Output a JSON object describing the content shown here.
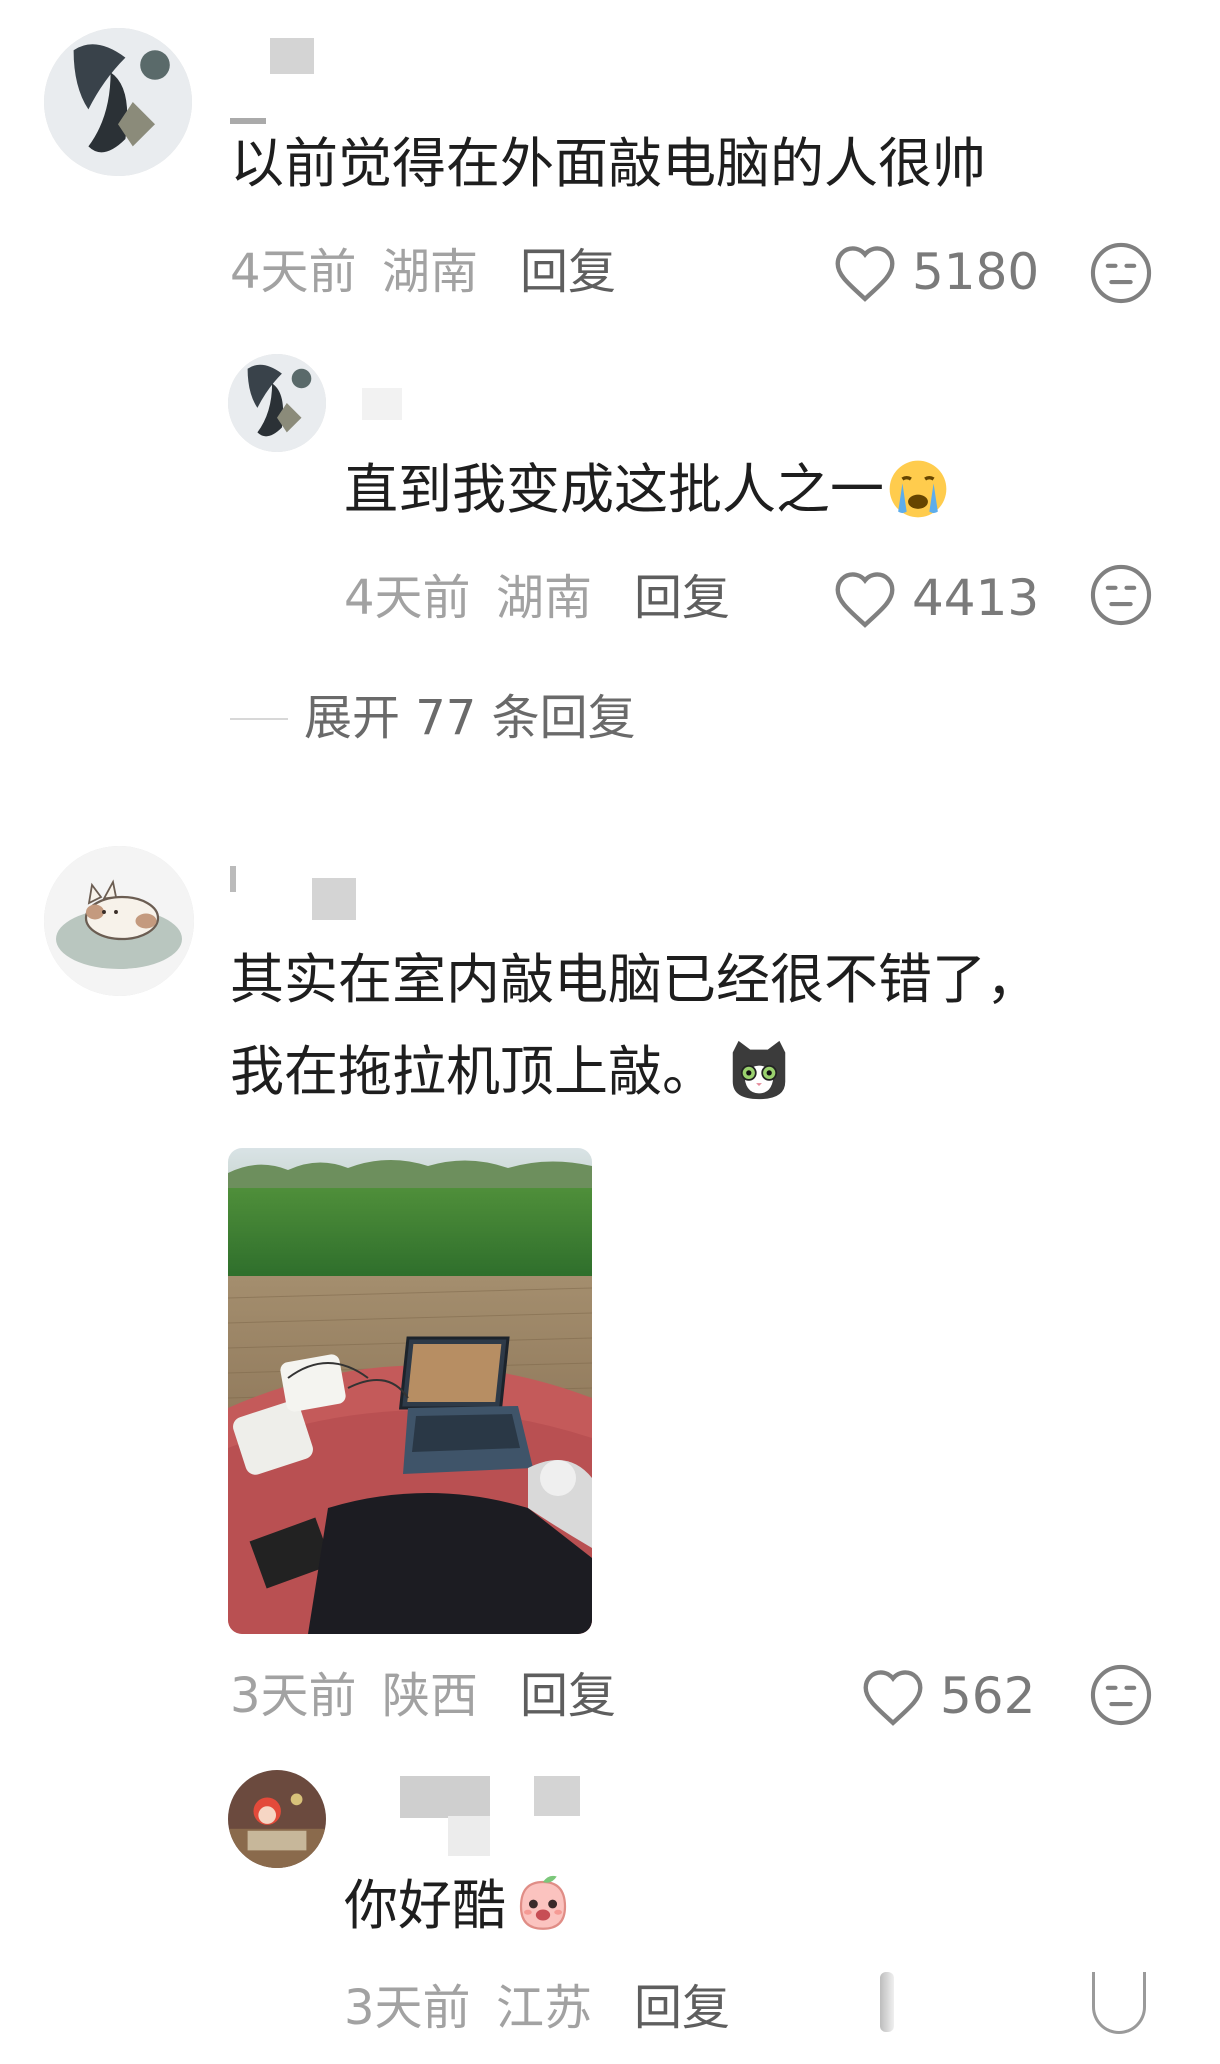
{
  "comments": [
    {
      "text": "以前觉得在外面敲电脑的人很帅",
      "time": "4天前",
      "location": "湖南",
      "reply_label": "回复",
      "likes": "5180",
      "replies": [
        {
          "text": "直到我变成这批人之一",
          "emoji": "crying-face",
          "time": "4天前",
          "location": "湖南",
          "reply_label": "回复",
          "likes": "4413"
        }
      ],
      "expand_label": "展开 77 条回复"
    },
    {
      "text_line1": "其实在室内敲电脑已经很不错了，",
      "text_line2": "我在拖拉机顶上敲。",
      "emoji": "cat-face",
      "image_desc": "laptop-on-tractor-photo",
      "time": "3天前",
      "location": "陕西",
      "reply_label": "回复",
      "likes": "562",
      "replies": [
        {
          "text": "你好酷",
          "emoji": "peach-face",
          "time": "3天前",
          "location": "江苏",
          "reply_label": "回复"
        }
      ]
    }
  ],
  "icons": {
    "like": "heart-outline-icon",
    "dislike": "meh-face-icon"
  },
  "colors": {
    "meta": "#a2a2a2",
    "reply": "#5e5e5e",
    "text": "#1e1e1e"
  }
}
